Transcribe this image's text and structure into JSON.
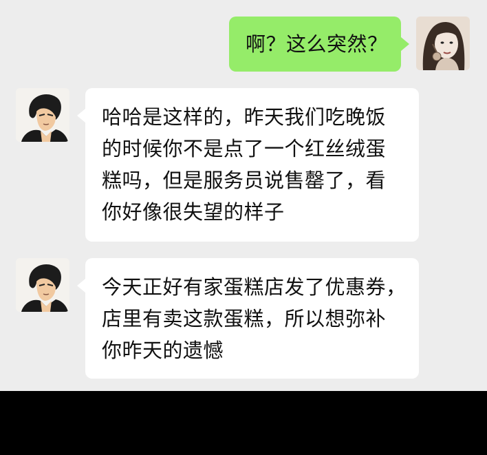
{
  "messages": [
    {
      "side": "right",
      "avatar": "female-avatar-icon",
      "lines": [
        "啊？这么突然？"
      ]
    },
    {
      "side": "left",
      "avatar": "male-avatar-icon",
      "lines": [
        "哈哈是这样的，昨天我们吃晚饭",
        "的时候你不是点了一个红丝绒蛋",
        "糕吗，但是服务员说售罄了，看",
        "你好像很失望的样子"
      ]
    },
    {
      "side": "left",
      "avatar": "male-avatar-icon",
      "lines": [
        "今天正好有家蛋糕店发了优惠券，",
        "店里有卖这款蛋糕，所以想弥补",
        "你昨天的遗憾"
      ]
    }
  ],
  "colors": {
    "chat_background": "#ededed",
    "outgoing_bubble": "#95ec69",
    "incoming_bubble": "#ffffff",
    "bottom_bar": "#000000"
  }
}
